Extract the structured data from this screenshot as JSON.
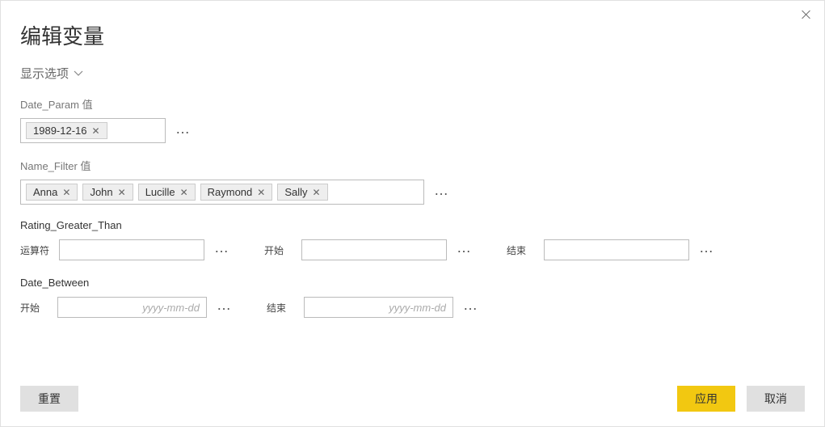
{
  "dialog": {
    "title": "编辑变量",
    "display_options_label": "显示选项"
  },
  "date_param": {
    "label": "Date_Param 值",
    "tags": [
      "1989-12-16"
    ]
  },
  "name_filter": {
    "label": "Name_Filter 值",
    "tags": [
      "Anna",
      "John",
      "Lucille",
      "Raymond",
      "Sally"
    ]
  },
  "rating_greater_than": {
    "label": "Rating_Greater_Than",
    "operator_label": "运算符",
    "start_label": "开始",
    "end_label": "结束",
    "operator_value": "",
    "start_value": "",
    "end_value": ""
  },
  "date_between": {
    "label": "Date_Between",
    "start_label": "开始",
    "end_label": "结束",
    "start_value": "",
    "end_value": "",
    "placeholder": "yyyy-mm-dd"
  },
  "footer": {
    "reset": "重置",
    "apply": "应用",
    "cancel": "取消"
  }
}
